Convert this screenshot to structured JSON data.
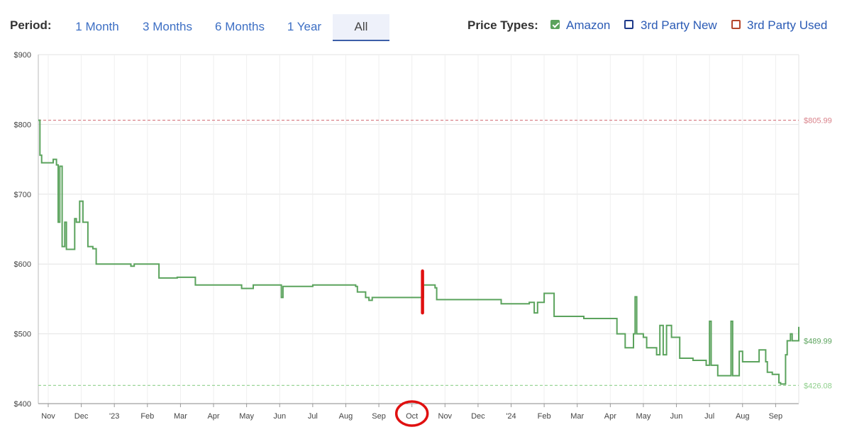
{
  "period": {
    "label": "Period:",
    "options": [
      "1 Month",
      "3 Months",
      "6 Months",
      "1 Year",
      "All"
    ],
    "selected": "All"
  },
  "price_types": {
    "label": "Price Types:",
    "items": [
      {
        "label": "Amazon",
        "checked": true,
        "color": "#5ba35d"
      },
      {
        "label": "3rd Party New",
        "checked": false,
        "color": "#1e3a8a"
      },
      {
        "label": "3rd Party Used",
        "checked": false,
        "color": "#b5462b"
      }
    ]
  },
  "colors": {
    "amazon_line": "#5ba35d",
    "max_ref": "#d9828a",
    "min_ref": "#8fcf8c",
    "annotation": "#e01010"
  },
  "annotation_icons": [
    "red-vertical-marker",
    "red-circle-around-oct"
  ],
  "chart_data": {
    "type": "line",
    "y_ticks": [
      "$900",
      "$800",
      "$700",
      "$600",
      "$500",
      "$400"
    ],
    "ylim": [
      400,
      900
    ],
    "x_ticks": [
      "Nov",
      "Dec",
      "'23",
      "Feb",
      "Mar",
      "Apr",
      "May",
      "Jun",
      "Jul",
      "Aug",
      "Sep",
      "Oct",
      "Nov",
      "Dec",
      "'24",
      "Feb",
      "Mar",
      "Apr",
      "May",
      "Jun",
      "Jul",
      "Aug",
      "Sep"
    ],
    "x_tick_months": [
      0,
      1,
      2,
      3,
      4,
      5,
      6,
      7,
      8,
      9,
      10,
      11,
      12,
      13,
      14,
      15,
      16,
      17,
      18,
      19,
      20,
      21,
      22
    ],
    "xlim": [
      -0.3,
      22.7
    ],
    "grid": true,
    "ref_lines": [
      {
        "label": "$805.99",
        "value": 805.99,
        "color": "#d9828a"
      },
      {
        "label": "$426.08",
        "value": 426.08,
        "color": "#8fcf8c"
      }
    ],
    "current_label": {
      "label": "$489.99",
      "value": 489.99
    },
    "series": [
      {
        "name": "Amazon",
        "step": true,
        "points": [
          [
            -0.3,
            806
          ],
          [
            -0.25,
            756
          ],
          [
            -0.2,
            745
          ],
          [
            0.1,
            745
          ],
          [
            0.15,
            750
          ],
          [
            0.25,
            742
          ],
          [
            0.3,
            660
          ],
          [
            0.35,
            740
          ],
          [
            0.42,
            625
          ],
          [
            0.5,
            660
          ],
          [
            0.55,
            621
          ],
          [
            0.75,
            621
          ],
          [
            0.8,
            665
          ],
          [
            0.85,
            660
          ],
          [
            0.95,
            690
          ],
          [
            1.05,
            660
          ],
          [
            1.2,
            625
          ],
          [
            1.35,
            622
          ],
          [
            1.45,
            600
          ],
          [
            2.0,
            600
          ],
          [
            2.5,
            597
          ],
          [
            2.6,
            600
          ],
          [
            3.3,
            600
          ],
          [
            3.35,
            580
          ],
          [
            3.9,
            581
          ],
          [
            4.45,
            570
          ],
          [
            5.8,
            570
          ],
          [
            5.85,
            565
          ],
          [
            6.2,
            570
          ],
          [
            7.0,
            570
          ],
          [
            7.05,
            552
          ],
          [
            7.1,
            568
          ],
          [
            8.0,
            570
          ],
          [
            9.3,
            568
          ],
          [
            9.35,
            560
          ],
          [
            9.6,
            552
          ],
          [
            9.7,
            548
          ],
          [
            9.8,
            552
          ],
          [
            11.3,
            552
          ],
          [
            11.35,
            570
          ],
          [
            11.7,
            566
          ],
          [
            11.75,
            549
          ],
          [
            13.7,
            543
          ],
          [
            14.55,
            545
          ],
          [
            14.7,
            530
          ],
          [
            14.8,
            545
          ],
          [
            15.0,
            558
          ],
          [
            15.3,
            525
          ],
          [
            16.2,
            522
          ],
          [
            16.8,
            522
          ],
          [
            17.2,
            500
          ],
          [
            17.45,
            480
          ],
          [
            17.7,
            500
          ],
          [
            17.75,
            553
          ],
          [
            17.8,
            500
          ],
          [
            18.0,
            495
          ],
          [
            18.1,
            480
          ],
          [
            18.4,
            470
          ],
          [
            18.5,
            512
          ],
          [
            18.6,
            470
          ],
          [
            18.7,
            512
          ],
          [
            18.85,
            495
          ],
          [
            19.1,
            465
          ],
          [
            19.5,
            462
          ],
          [
            19.9,
            455
          ],
          [
            20.0,
            518
          ],
          [
            20.05,
            455
          ],
          [
            20.25,
            440
          ],
          [
            20.65,
            518
          ],
          [
            20.7,
            440
          ],
          [
            20.9,
            475
          ],
          [
            21.0,
            460
          ],
          [
            21.5,
            477
          ],
          [
            21.7,
            460
          ],
          [
            21.75,
            445
          ],
          [
            21.9,
            442
          ],
          [
            22.1,
            430
          ],
          [
            22.15,
            428
          ],
          [
            22.3,
            470
          ],
          [
            22.35,
            490
          ],
          [
            22.45,
            500
          ],
          [
            22.5,
            490
          ],
          [
            22.7,
            510
          ]
        ]
      }
    ]
  }
}
